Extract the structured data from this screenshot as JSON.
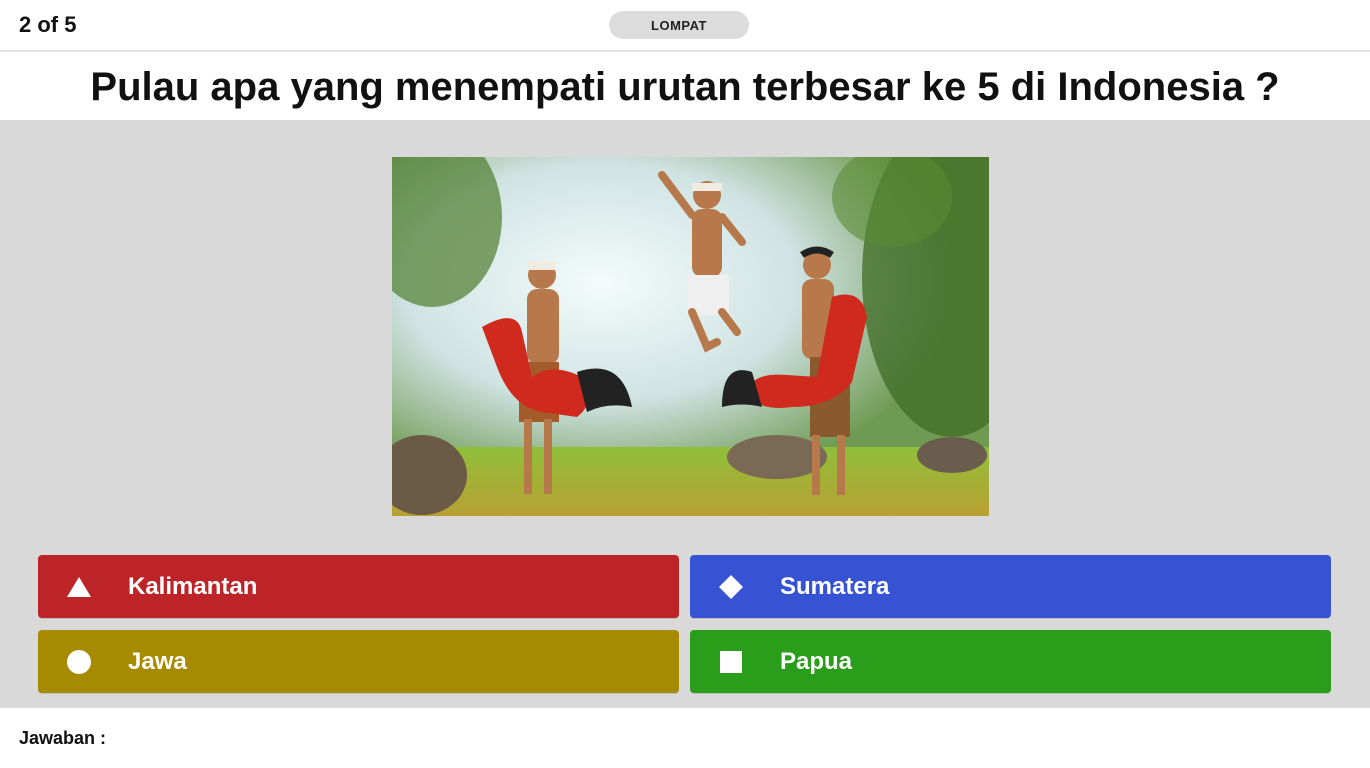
{
  "header": {
    "progress": "2 of 5",
    "skip_label": "LOMPAT"
  },
  "question": {
    "text": "Pulau apa yang menempati urutan terbesar ke 5 di Indonesia ?"
  },
  "image": {
    "alt": "Anak-anak menari kuda lumping"
  },
  "answers": [
    {
      "label": "Kalimantan",
      "shape": "triangle-icon",
      "color": "#bd2427"
    },
    {
      "label": "Sumatera",
      "shape": "diamond-icon",
      "color": "#3653d3"
    },
    {
      "label": "Jawa",
      "shape": "circle-icon",
      "color": "#a68b00"
    },
    {
      "label": "Papua",
      "shape": "square-icon",
      "color": "#2a9d1a"
    }
  ],
  "footer": {
    "answer_label": "Jawaban :"
  }
}
